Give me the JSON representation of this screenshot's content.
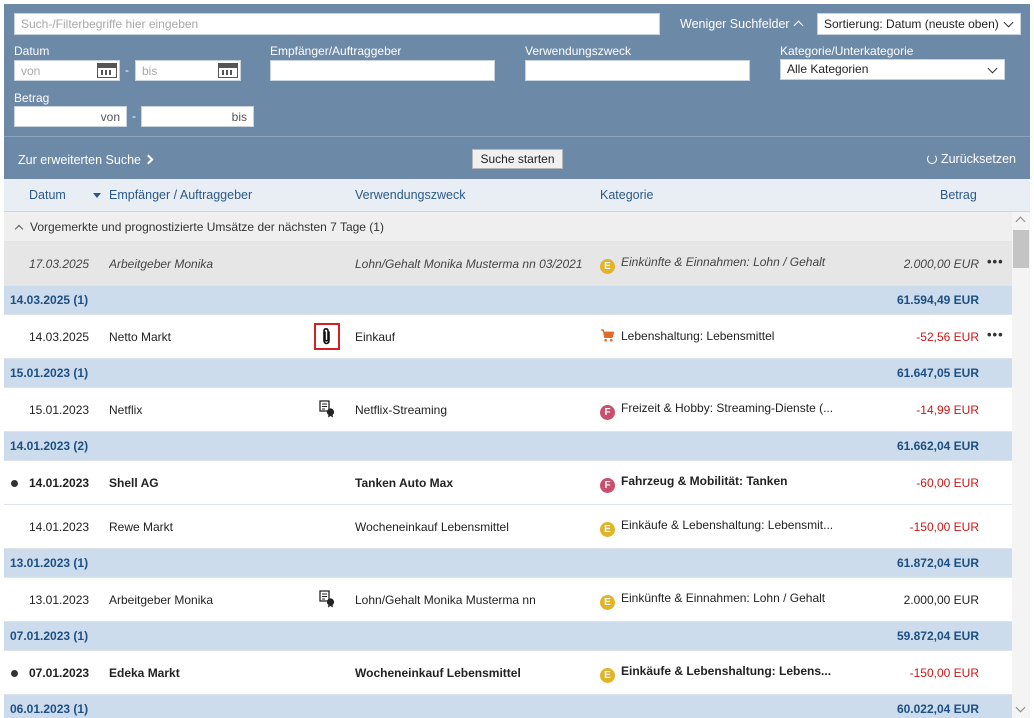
{
  "search": {
    "placeholder": "Such-/Filterbegriffe hier eingeben",
    "fewer_fields": "Weniger Suchfelder",
    "sort_value": "Sortierung: Datum (neuste oben)"
  },
  "filters": {
    "date_label": "Datum",
    "date_from_placeholder": "von",
    "date_to_placeholder": "bis",
    "payee_label": "Empfänger/Auftraggeber",
    "purpose_label": "Verwendungszweck",
    "category_label": "Kategorie/Unterkategorie",
    "category_value": "Alle Kategorien",
    "amount_label": "Betrag",
    "amount_from_placeholder": "von",
    "amount_to_placeholder": "bis",
    "separator": "-"
  },
  "actions": {
    "extended_search": "Zur erweiterten Suche",
    "start_search": "Suche starten",
    "reset": "Zurücksetzen"
  },
  "table": {
    "headers": {
      "date": "Datum",
      "payee": "Empfänger / Auftraggeber",
      "purpose": "Verwendungszweck",
      "category": "Kategorie",
      "amount": "Betrag"
    },
    "pending_title": "Vorgemerkte und prognostizierte Umsätze der nächsten 7 Tage (1)",
    "rows": [
      {
        "kind": "pending",
        "date": "17.03.2025",
        "payee": "Arbeitgeber Monika",
        "purpose": "Lohn/Gehalt Monika Musterma nn 03/2021",
        "badge": "E",
        "category": "Einkünfte & Einnahmen: Lohn / Gehalt",
        "amount": "2.000,00 EUR",
        "more": "•••"
      },
      {
        "kind": "group",
        "date": "14.03.2025 (1)",
        "balance": "61.594,49 EUR"
      },
      {
        "kind": "tx",
        "date": "14.03.2025",
        "payee": "Netto Markt",
        "icon": "paperclip-icon",
        "purpose": "Einkauf",
        "badge": "cart",
        "category": "Lebenshaltung: Lebensmittel",
        "amount": "-52,56 EUR",
        "more": "•••"
      },
      {
        "kind": "group",
        "date": "15.01.2023 (1)",
        "balance": "61.647,05 EUR"
      },
      {
        "kind": "tx",
        "date": "15.01.2023",
        "payee": "Netflix",
        "icon": "document-badge-icon",
        "purpose": "Netflix-Streaming",
        "badge": "F",
        "category": "Freizeit & Hobby: Streaming-Dienste (...",
        "amount": "-14,99 EUR"
      },
      {
        "kind": "group",
        "date": "14.01.2023 (2)",
        "balance": "61.662,04 EUR"
      },
      {
        "kind": "tx",
        "bold": true,
        "unread": true,
        "date": "14.01.2023",
        "payee": "Shell AG",
        "purpose": "Tanken Auto Max",
        "badge": "F",
        "category": "Fahrzeug & Mobilität: Tanken",
        "amount": "-60,00 EUR"
      },
      {
        "kind": "tx",
        "date": "14.01.2023",
        "payee": "Rewe Markt",
        "purpose": "Wocheneinkauf Lebensmittel",
        "badge": "E",
        "category": "Einkäufe & Lebenshaltung: Lebensmit...",
        "amount": "-150,00 EUR"
      },
      {
        "kind": "group",
        "date": "13.01.2023 (1)",
        "balance": "61.872,04 EUR"
      },
      {
        "kind": "tx",
        "date": "13.01.2023",
        "payee": "Arbeitgeber Monika",
        "icon": "document-badge-icon",
        "purpose": "Lohn/Gehalt Monika Musterma nn",
        "badge": "E",
        "category": "Einkünfte & Einnahmen: Lohn / Gehalt",
        "amount": "2.000,00 EUR"
      },
      {
        "kind": "group",
        "date": "07.01.2023 (1)",
        "balance": "59.872,04 EUR"
      },
      {
        "kind": "tx",
        "bold": true,
        "unread": true,
        "date": "07.01.2023",
        "payee": "Edeka Markt",
        "purpose": "Wocheneinkauf Lebensmittel",
        "badge": "E",
        "category": "Einkäufe & Lebenshaltung: Lebens...",
        "amount": "-150,00 EUR"
      },
      {
        "kind": "group",
        "date": "06.01.2023 (1)",
        "balance": "60.022,04 EUR"
      }
    ]
  },
  "colors": {
    "panel": "#6d89a8",
    "header": "#e9eef4",
    "group_row": "#ccdcec",
    "negative": "#c81818",
    "link": "#1d4f82",
    "badge_e": "#e2b228",
    "badge_f": "#c94f6e",
    "highlight": "#d32020"
  }
}
